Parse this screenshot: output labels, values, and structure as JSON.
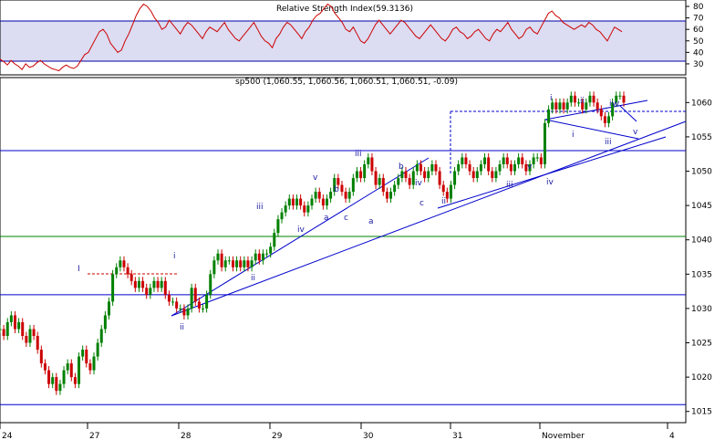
{
  "chart_data": [
    {
      "type": "line",
      "title": "Relative Strength Index(59.3136)",
      "ylim": [
        22,
        84
      ],
      "y_ticks": [
        30,
        40,
        50,
        60,
        70,
        80
      ],
      "reference_lines": [
        70,
        30
      ],
      "series_color": "#cc0000",
      "values": [
        34,
        32,
        29,
        33,
        30,
        28,
        25,
        30,
        27,
        28,
        31,
        33,
        30,
        28,
        26,
        25,
        24,
        27,
        29,
        27,
        26,
        28,
        33,
        38,
        40,
        46,
        52,
        58,
        60,
        56,
        48,
        44,
        40,
        42,
        50,
        56,
        64,
        72,
        78,
        82,
        80,
        76,
        70,
        66,
        60,
        62,
        68,
        64,
        60,
        56,
        62,
        66,
        64,
        60,
        56,
        52,
        58,
        62,
        60,
        58,
        62,
        66,
        60,
        56,
        52,
        50,
        54,
        58,
        62,
        66,
        60,
        54,
        50,
        48,
        44,
        52,
        56,
        62,
        66,
        64,
        60,
        56,
        52,
        58,
        62,
        68,
        72,
        74,
        78,
        82,
        80,
        74,
        70,
        66,
        60,
        58,
        62,
        56,
        50,
        48,
        52,
        58,
        64,
        68,
        64,
        60,
        56,
        60,
        64,
        68,
        66,
        62,
        58,
        54,
        52,
        56,
        60,
        64,
        60,
        56,
        52,
        50,
        54,
        60,
        62,
        58,
        56,
        52,
        54,
        58,
        60,
        56,
        52,
        50,
        56,
        60,
        58,
        62,
        66,
        60,
        56,
        52,
        54,
        60,
        62,
        58,
        56,
        62,
        68,
        74,
        76,
        72,
        70,
        66,
        64,
        62,
        60,
        62,
        64,
        62,
        66,
        64,
        60,
        58,
        54,
        50,
        56,
        62,
        60,
        58
      ]
    },
    {
      "type": "line",
      "title": "sp500 (1,060.55, 1,060.56, 1,060.51, 1,060.51, -0.09)",
      "x_tick_labels": [
        "24",
        "27",
        "28",
        "29",
        "30",
        "31",
        "November",
        "4"
      ],
      "y_ticks": [
        1015,
        1020,
        1025,
        1030,
        1035,
        1040,
        1045,
        1050,
        1055,
        1060
      ],
      "ylim": [
        1013.5,
        1063.5
      ],
      "series_color": "#008000",
      "down_color": "#cc0000",
      "horizontal_levels": [
        {
          "value": 1053,
          "color": "#0000cc"
        },
        {
          "value": 1040.5,
          "color": "#008000"
        },
        {
          "value": 1032,
          "color": "#0000cc"
        },
        {
          "value": 1016,
          "color": "#0000cc"
        }
      ],
      "wave_labels": [
        "I",
        "i",
        "ii",
        "iii",
        "iv",
        "v",
        "ii",
        "iii",
        "iv",
        "a",
        "b",
        "c",
        "a",
        "b",
        "c",
        "i",
        "ii",
        "iii",
        "iv",
        "v",
        "i",
        "ii",
        "iii",
        "iv",
        "v",
        "v"
      ],
      "values": [
        1027,
        1026,
        1028,
        1029,
        1027,
        1028,
        1026,
        1025,
        1027,
        1026,
        1024,
        1022,
        1021,
        1019,
        1020,
        1018,
        1019,
        1021,
        1022,
        1020,
        1019,
        1023,
        1024,
        1022,
        1021,
        1023,
        1025,
        1027,
        1029,
        1031,
        1035,
        1036,
        1037,
        1036,
        1035,
        1034,
        1033,
        1034,
        1033,
        1032,
        1033,
        1034,
        1033,
        1034,
        1032,
        1031,
        1031,
        1030,
        1030,
        1029,
        1030,
        1033,
        1031,
        1030,
        1030,
        1032,
        1035,
        1037,
        1038,
        1036,
        1037,
        1037,
        1036,
        1037,
        1036,
        1037,
        1036,
        1037,
        1038,
        1037,
        1038,
        1038,
        1039,
        1041,
        1043,
        1044,
        1045,
        1046,
        1045,
        1046,
        1045,
        1044,
        1045,
        1046,
        1047,
        1046,
        1045,
        1046,
        1047,
        1049,
        1048,
        1047,
        1046,
        1047,
        1049,
        1050,
        1049,
        1051,
        1052,
        1050,
        1048,
        1049,
        1047,
        1046,
        1047,
        1048,
        1049,
        1050,
        1049,
        1048,
        1050,
        1051,
        1050,
        1049,
        1050,
        1051,
        1050,
        1048,
        1047,
        1046,
        1048,
        1050,
        1051,
        1052,
        1051,
        1050,
        1049,
        1050,
        1051,
        1052,
        1050,
        1049,
        1050,
        1051,
        1052,
        1051,
        1050,
        1051,
        1052,
        1051,
        1050,
        1051,
        1052,
        1052,
        1051,
        1057,
        1059,
        1060,
        1059,
        1060,
        1059,
        1060,
        1061,
        1060,
        1060,
        1059,
        1060,
        1061,
        1060,
        1059,
        1058,
        1057,
        1058,
        1060,
        1061,
        1061,
        1060
      ]
    }
  ]
}
